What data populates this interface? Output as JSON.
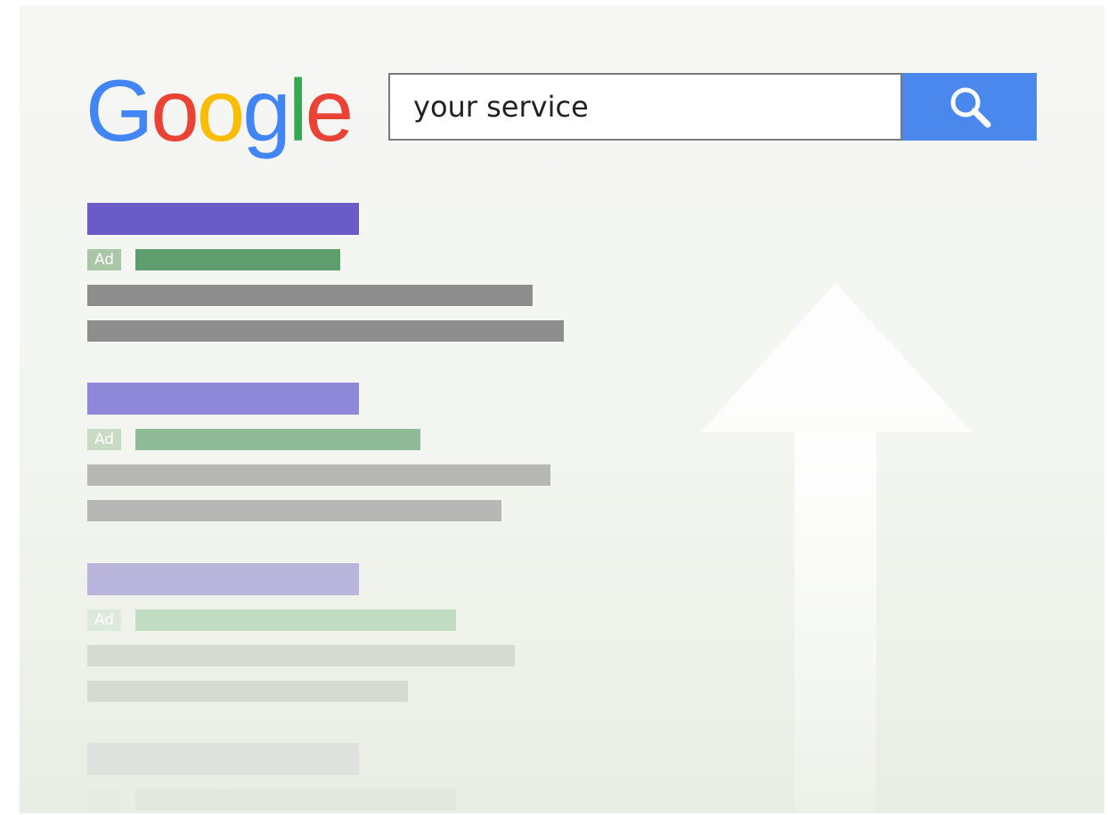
{
  "logo": {
    "letters": [
      "G",
      "o",
      "o",
      "g",
      "l",
      "e"
    ],
    "colors": [
      "#4285f4",
      "#ea4335",
      "#fbbc05",
      "#4285f4",
      "#34a853",
      "#ea4335"
    ]
  },
  "search": {
    "value": "your service",
    "button_icon": "magnifier-icon",
    "button_color": "#4a88ee"
  },
  "results": [
    {
      "ad_label": "Ad",
      "title_color": "#6a5bc9",
      "url_color": "#5e9e6e",
      "snippet_color": "#8e8e8e",
      "badge_bg": "#a9c6a6",
      "opacity": 1.0
    },
    {
      "ad_label": "Ad",
      "title_color": "#8f87d8",
      "url_color": "#8fbb98",
      "snippet_color": "#b7b8b5",
      "badge_bg": "#c8dbc4",
      "opacity": 1.0
    },
    {
      "ad_label": "Ad",
      "title_color": "#b8b4dc",
      "url_color": "#c0dcc3",
      "snippet_color": "#d7d9d3",
      "badge_bg": "#dde9da",
      "opacity": 1.0
    },
    {
      "ad_label": "",
      "title_color": "#dfe1df",
      "url_color": "#e2e8df",
      "snippet_color": "#e6e9e3",
      "badge_bg": "#e6ece3",
      "opacity": 1.0
    }
  ],
  "decor": {
    "arrow_icon": "up-arrow-icon",
    "arrow_color": "#ffffff"
  }
}
